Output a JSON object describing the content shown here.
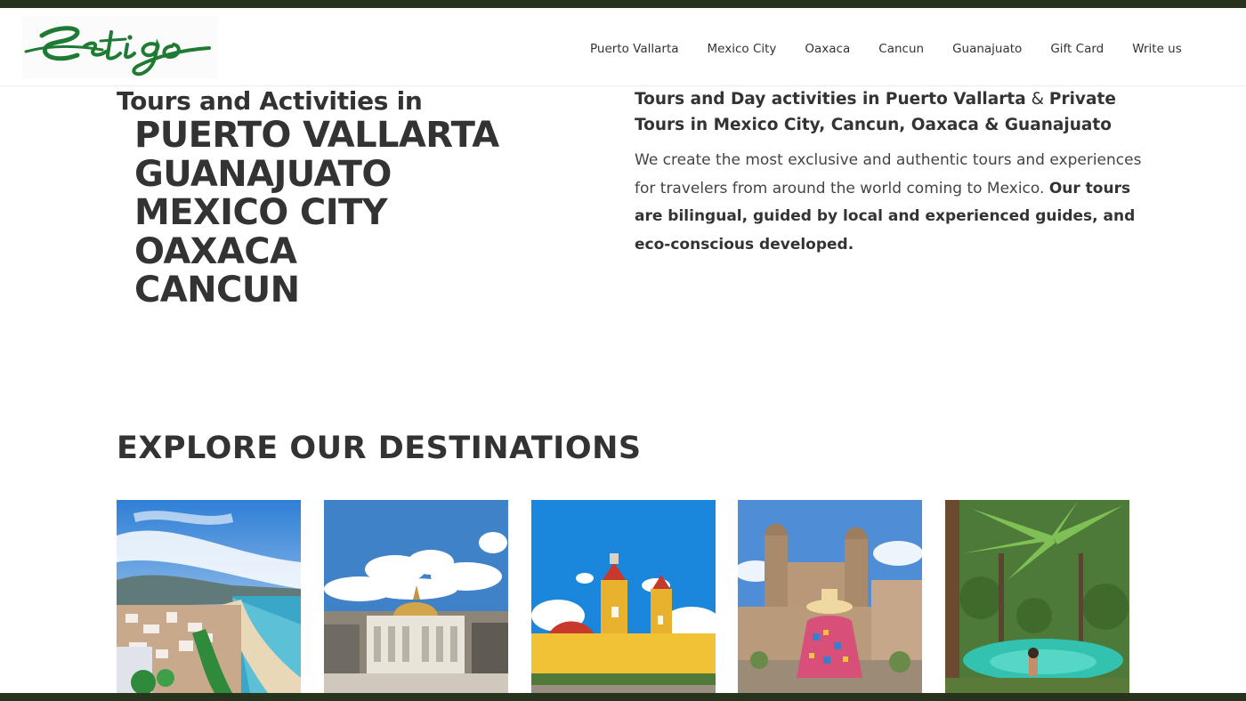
{
  "header": {
    "logo_text": "Estigo",
    "nav": [
      {
        "label": "Puerto Vallarta"
      },
      {
        "label": "Mexico City"
      },
      {
        "label": "Oaxaca"
      },
      {
        "label": "Cancun"
      },
      {
        "label": "Guanajuato"
      },
      {
        "label": "Gift Card"
      },
      {
        "label": "Write us"
      }
    ]
  },
  "hero": {
    "lead": "Tours and Activities in",
    "cities": [
      "PUERTO VALLARTA",
      "GUANAJUATO",
      "MEXICO CITY",
      "OAXACA",
      "CANCUN"
    ],
    "intro": {
      "p1": "Tours and Day activities in ",
      "p2": "Puerto Vallarta",
      "p3": " & ",
      "p4": "Private Tours in Mexico City, Cancun, Oaxaca & Guanajuato"
    },
    "body": {
      "normal": "We create the most exclusive and authentic tours and experiences for travelers from around the world coming to Mexico. ",
      "bold": "Our tours are bilingual, guided by local and experienced guides, and eco-conscious developed."
    }
  },
  "destinations": {
    "title": "EXPLORE OUR DESTINATIONS",
    "cards": [
      {
        "name": "puerto-vallarta"
      },
      {
        "name": "mexico-city"
      },
      {
        "name": "guanajuato"
      },
      {
        "name": "oaxaca"
      },
      {
        "name": "cancun"
      }
    ]
  },
  "colors": {
    "accent_dark_green": "#26331d",
    "logo_green": "#1f7a33",
    "text": "#333333"
  }
}
